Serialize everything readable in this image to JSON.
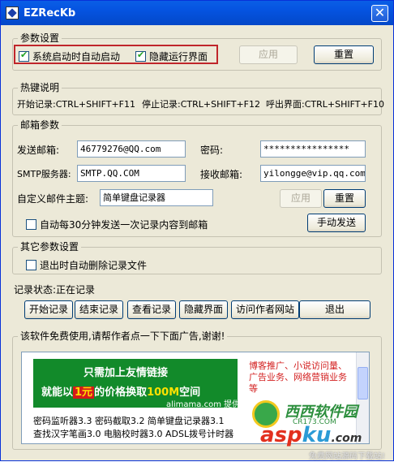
{
  "window": {
    "title": "EZRecKb",
    "close_glyph": "✕"
  },
  "params": {
    "group_title": "参数设置",
    "auto_start": {
      "label": "系统启动时自动启动",
      "checked": true
    },
    "hide_ui": {
      "label": "隐藏运行界面",
      "checked": true
    },
    "apply_label": "应用",
    "reset_label": "重置",
    "highlight_color": "#c0262b"
  },
  "hotkeys": {
    "group_title": "热键说明",
    "start": "开始记录:CTRL+SHIFT+F11",
    "stop": "停止记录:CTRL+SHIFT+F12",
    "show": "呼出界面:CTRL+SHIFT+F10"
  },
  "mail": {
    "group_title": "邮箱参数",
    "sender_label": "发送邮箱:",
    "sender_value": "46779276@QQ.com",
    "password_label": "密码:",
    "password_value": "****************",
    "smtp_label": "SMTP服务器:",
    "smtp_value": "SMTP.QQ.COM",
    "receiver_label": "接收邮箱:",
    "receiver_value": "yilongge@vip.qq.com",
    "subject_label": "自定义邮件主题:",
    "subject_value": "简单键盘记录器",
    "apply_label": "应用",
    "reset_label": "重置",
    "auto_send": {
      "label": "自动每30分钟发送一次记录内容到邮箱",
      "checked": false
    },
    "manual_send_label": "手动发送"
  },
  "other": {
    "group_title": "其它参数设置",
    "delete_on_exit": {
      "label": "退出时自动删除记录文件",
      "checked": false
    }
  },
  "status": {
    "label": "记录状态:正在记录"
  },
  "actions": {
    "start": "开始记录",
    "stop": "结束记录",
    "view": "查看记录",
    "hide": "隐藏界面",
    "visit": "访问作者网站",
    "exit": "退出"
  },
  "ad": {
    "group_title": "该软件免费使用,请帮作者点一下下面广告,谢谢!",
    "banner_line1": "只需加上友情链接",
    "banner_line2_prefix": "就能以",
    "banner_line2_price": "1元",
    "banner_line2_mid": "的价格换取",
    "banner_line2_amount": "100M",
    "banner_line2_suffix": "空间",
    "banner_brand": "alimama.com 提供",
    "banner_color": "#128a2a",
    "side_text": "博客推广、小说访问量、广告业务、网络营销业务等",
    "text_line1": "密码监听器3.3 密码截取3.2 简单键盘记录器3.1",
    "text_line2": "查找汉字笔画3.0 电脑校时器3.0 ADSL拨号计时器"
  },
  "watermark": {
    "site_cn": "西西软件园",
    "site_en": "CR173.COM",
    "asp": "asp",
    "ku": "ku",
    "tld": ".com",
    "tagline": "免费网站源码下载站!"
  }
}
